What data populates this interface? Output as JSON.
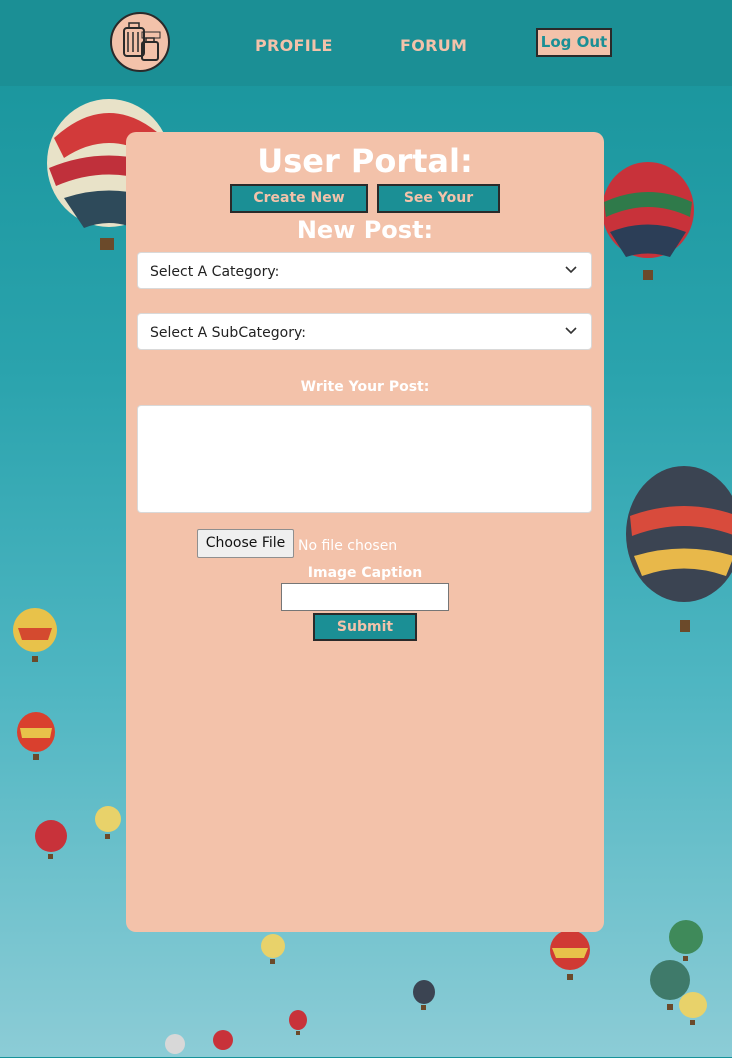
{
  "header": {
    "nav": {
      "profile": "PROFILE",
      "forum": "FORUM"
    },
    "logout_label": "Log Out"
  },
  "portal": {
    "title": "User Portal:",
    "tabs": {
      "create": "Create New Post:",
      "see": "See Your Posts:"
    },
    "section_title": "New Post:"
  },
  "form": {
    "category": {
      "selected": "Select A Category:"
    },
    "subcategory": {
      "selected": "Select A SubCategory:"
    },
    "post_label": "Write Your Post:",
    "post_value": "",
    "file": {
      "button_label": "Choose File",
      "status": "No file chosen"
    },
    "caption_label": "Image Caption",
    "caption_value": "",
    "submit_label": "Submit Post!"
  },
  "colors": {
    "header_bg": "#1b8f95",
    "panel_bg": "#f3c2aa",
    "accent": "#1b8f95",
    "text_light": "#ffffff"
  },
  "icons": [
    "luggage-logo-icon",
    "chevron-down-icon"
  ]
}
